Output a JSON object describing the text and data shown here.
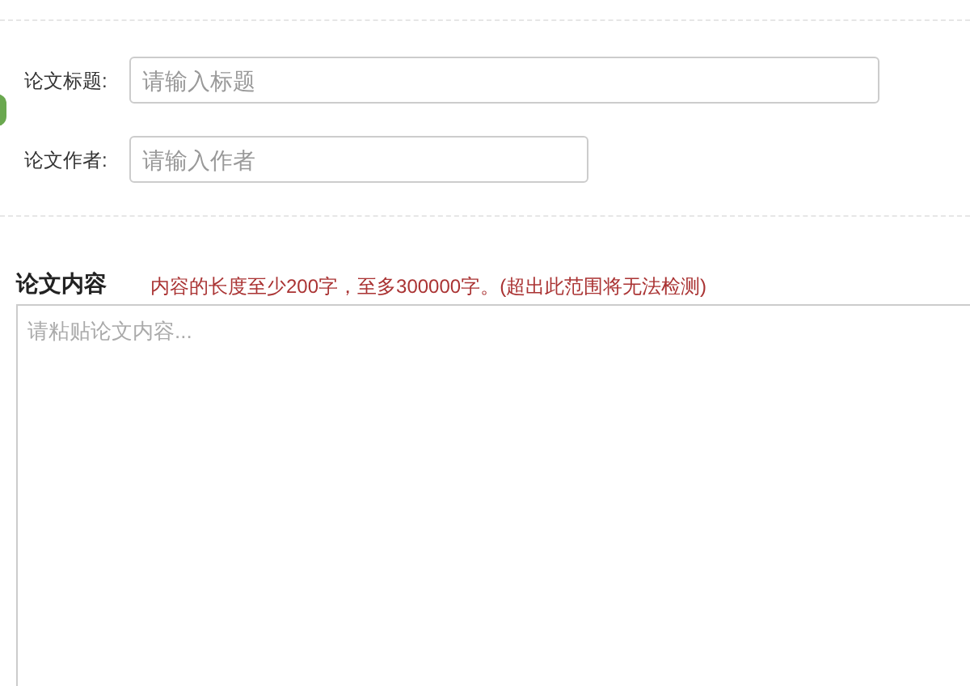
{
  "fields": [
    {
      "label": "论文标题:",
      "placeholder": "请输入标题",
      "kind": "wide"
    },
    {
      "label": "论文作者:",
      "placeholder": "请输入作者",
      "kind": "narrow"
    }
  ],
  "content": {
    "heading": "论文内容",
    "note": "内容的长度至少200字，至多300000字。(超出此范围将无法检测)",
    "placeholder": "请粘贴论文内容..."
  }
}
